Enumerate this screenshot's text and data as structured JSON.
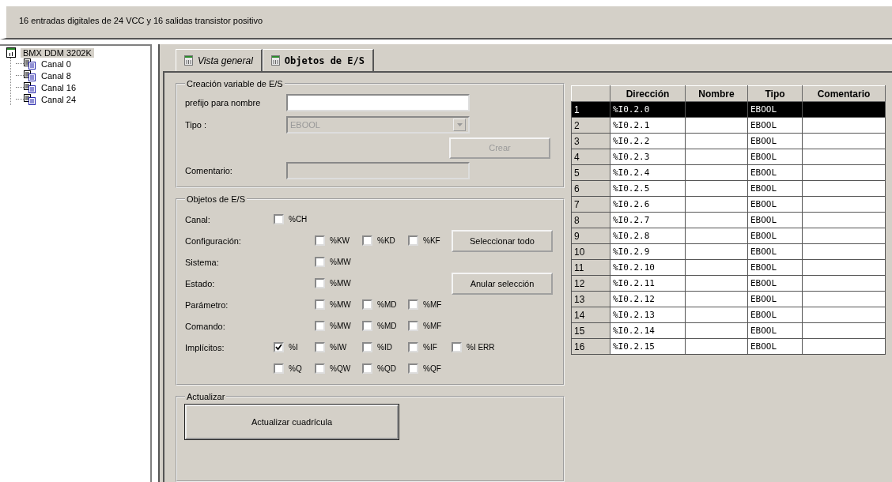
{
  "header": {
    "description": "16 entradas digitales de 24 VCC y 16 salidas transistor positivo"
  },
  "tree": {
    "root": {
      "label": "BMX DDM 3202K",
      "selected": true,
      "children": [
        {
          "label": "Canal 0"
        },
        {
          "label": "Canal 8"
        },
        {
          "label": "Canal 16"
        },
        {
          "label": "Canal 24"
        }
      ]
    }
  },
  "tabs": [
    {
      "label": "Vista general",
      "selected": false
    },
    {
      "label": "Objetos de E/S",
      "selected": true
    }
  ],
  "creation": {
    "title": "Creación variable de E/S",
    "prefix_label": "prefijo para nombre",
    "type_label": "Tipo :",
    "type_value": "EBOOL",
    "type_disabled": true,
    "create_button": {
      "label": "Crear",
      "disabled": true
    },
    "comment_label": "Comentario:",
    "comment_disabled": true
  },
  "objects": {
    "title": "Objetos de E/S",
    "select_all": "Seleccionar todo",
    "deselect": "Anular selección",
    "rows": [
      {
        "label": "Canal:",
        "kind": "channel",
        "items": [
          {
            "label": "%CH",
            "checked": false
          }
        ]
      },
      {
        "label": "Configuración:",
        "kind": "register",
        "items": [
          {
            "label": "%KW",
            "checked": false
          },
          {
            "label": "%KD",
            "checked": false
          },
          {
            "label": "%KF",
            "checked": false
          }
        ]
      },
      {
        "label": "Sistema:",
        "kind": "register",
        "items": [
          {
            "label": "%MW",
            "checked": false
          }
        ]
      },
      {
        "label": "Estado:",
        "kind": "register",
        "items": [
          {
            "label": "%MW",
            "checked": false
          }
        ]
      },
      {
        "label": "Parámetro:",
        "kind": "register",
        "items": [
          {
            "label": "%MW",
            "checked": false
          },
          {
            "label": "%MD",
            "checked": false
          },
          {
            "label": "%MF",
            "checked": false
          }
        ]
      },
      {
        "label": "Comando:",
        "kind": "register",
        "items": [
          {
            "label": "%MW",
            "checked": false
          },
          {
            "label": "%MD",
            "checked": false
          },
          {
            "label": "%MF",
            "checked": false
          }
        ]
      },
      {
        "label": "Implícitos:",
        "kind": "implicit",
        "items": [
          {
            "label": "%I",
            "checked": true
          },
          {
            "label": "%IW",
            "checked": false
          },
          {
            "label": "%ID",
            "checked": false
          },
          {
            "label": "%IF",
            "checked": false
          },
          {
            "label": "%I ERR",
            "checked": false
          }
        ]
      },
      {
        "kind": "implicit",
        "items": [
          {
            "label": "%Q",
            "checked": false
          },
          {
            "label": "%QW",
            "checked": false
          },
          {
            "label": "%QD",
            "checked": false
          },
          {
            "label": "%QF",
            "checked": false
          }
        ]
      }
    ]
  },
  "refresh": {
    "title": "Actualizar",
    "button": "Actualizar cuadrícula"
  },
  "table": {
    "columns": [
      "Dirección",
      "Nombre",
      "Tipo",
      "Comentario"
    ],
    "rows": [
      {
        "index": "1",
        "address": "%I0.2.0",
        "type": "EBOOL",
        "selected": true
      },
      {
        "index": "2",
        "address": "%I0.2.1",
        "type": "EBOOL",
        "selected": false
      },
      {
        "index": "3",
        "address": "%I0.2.2",
        "type": "EBOOL",
        "selected": false
      },
      {
        "index": "4",
        "address": "%I0.2.3",
        "type": "EBOOL",
        "selected": false
      },
      {
        "index": "5",
        "address": "%I0.2.4",
        "type": "EBOOL",
        "selected": false
      },
      {
        "index": "6",
        "address": "%I0.2.5",
        "type": "EBOOL",
        "selected": false
      },
      {
        "index": "7",
        "address": "%I0.2.6",
        "type": "EBOOL",
        "selected": false
      },
      {
        "index": "8",
        "address": "%I0.2.7",
        "type": "EBOOL",
        "selected": false
      },
      {
        "index": "9",
        "address": "%I0.2.8",
        "type": "EBOOL",
        "selected": false
      },
      {
        "index": "10",
        "address": "%I0.2.9",
        "type": "EBOOL",
        "selected": false
      },
      {
        "index": "11",
        "address": "%I0.2.10",
        "type": "EBOOL",
        "selected": false
      },
      {
        "index": "12",
        "address": "%I0.2.11",
        "type": "EBOOL",
        "selected": false
      },
      {
        "index": "13",
        "address": "%I0.2.12",
        "type": "EBOOL",
        "selected": false
      },
      {
        "index": "14",
        "address": "%I0.2.13",
        "type": "EBOOL",
        "selected": false
      },
      {
        "index": "15",
        "address": "%I0.2.14",
        "type": "EBOOL",
        "selected": false
      },
      {
        "index": "16",
        "address": "%I0.2.15",
        "type": "EBOOL",
        "selected": false
      }
    ]
  }
}
